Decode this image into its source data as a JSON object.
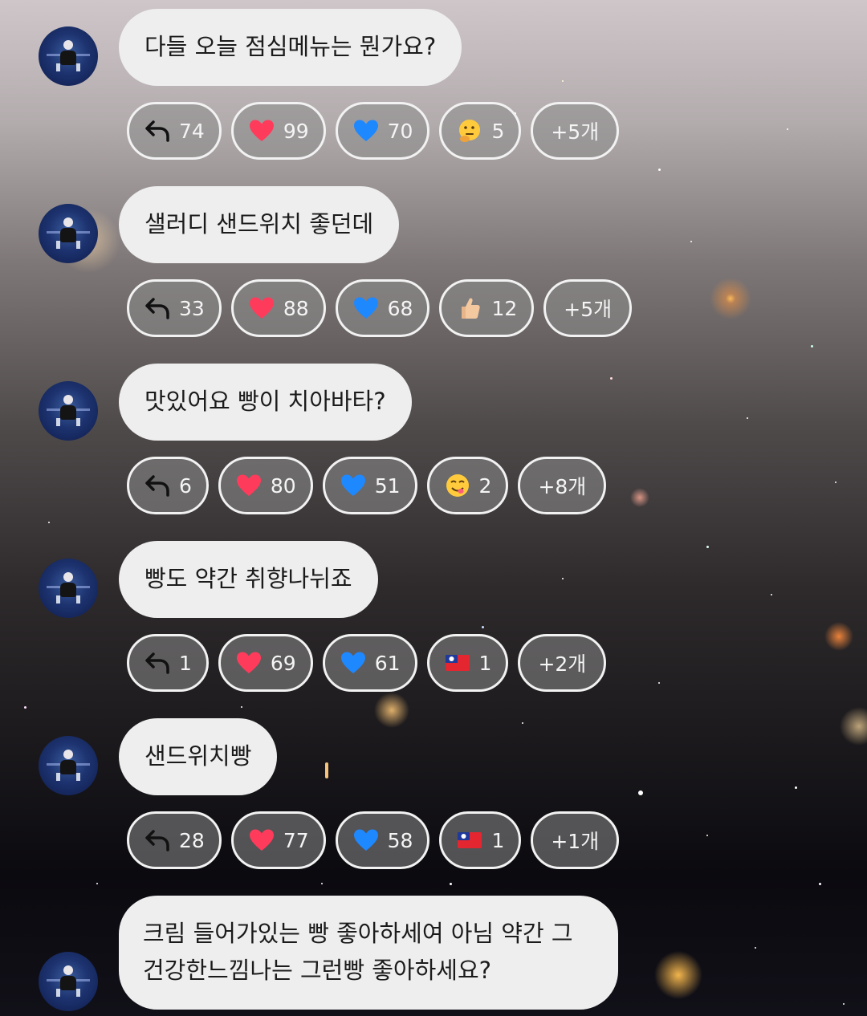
{
  "messages": [
    {
      "text": "다들 오늘 점심메뉴는 뭔가요?",
      "reactions": [
        {
          "icon": "reply-arrow-icon",
          "count": "74"
        },
        {
          "icon": "red-heart-icon",
          "count": "99"
        },
        {
          "icon": "blue-heart-icon",
          "count": "70"
        },
        {
          "icon": "thinking-face-icon",
          "count": "5"
        }
      ],
      "more": "+5개"
    },
    {
      "text": "샐러디 샌드위치 좋던데",
      "reactions": [
        {
          "icon": "reply-arrow-icon",
          "count": "33"
        },
        {
          "icon": "red-heart-icon",
          "count": "88"
        },
        {
          "icon": "blue-heart-icon",
          "count": "68"
        },
        {
          "icon": "thumbs-up-icon",
          "count": "12"
        }
      ],
      "more": "+5개"
    },
    {
      "text": "맛있어요 빵이 치아바타?",
      "reactions": [
        {
          "icon": "reply-arrow-icon",
          "count": "6"
        },
        {
          "icon": "red-heart-icon",
          "count": "80"
        },
        {
          "icon": "blue-heart-icon",
          "count": "51"
        },
        {
          "icon": "yum-face-icon",
          "count": "2"
        }
      ],
      "more": "+8개"
    },
    {
      "text": "빵도 약간 취향나뉘죠",
      "reactions": [
        {
          "icon": "reply-arrow-icon",
          "count": "1"
        },
        {
          "icon": "red-heart-icon",
          "count": "69"
        },
        {
          "icon": "blue-heart-icon",
          "count": "61"
        },
        {
          "icon": "taiwan-flag-icon",
          "count": "1"
        }
      ],
      "more": "+2개"
    },
    {
      "text": "샌드위치빵",
      "reactions": [
        {
          "icon": "reply-arrow-icon",
          "count": "28"
        },
        {
          "icon": "red-heart-icon",
          "count": "77"
        },
        {
          "icon": "blue-heart-icon",
          "count": "58"
        },
        {
          "icon": "taiwan-flag-icon",
          "count": "1"
        }
      ],
      "more": "+1개"
    },
    {
      "text": "크림 들어가있는 빵 좋아하세여 아님 약간 그 건강한느낌나는 그런빵 좋아하세요?",
      "reactions": [],
      "more": ""
    }
  ],
  "colors": {
    "bubble_bg": "#eeeeee",
    "chip_border": "#f2f2f2",
    "red_heart": "#ff3b5c",
    "blue_heart": "#1e88ff"
  }
}
